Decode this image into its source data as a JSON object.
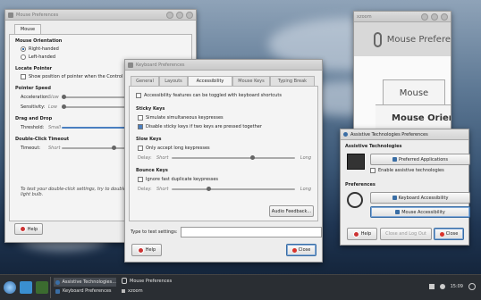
{
  "mouse_window": {
    "title": "Mouse Preferences",
    "tab": "Mouse",
    "orientation_heading": "Mouse Orientation",
    "right_handed": "Right-handed",
    "left_handed": "Left-handed",
    "locate_heading": "Locate Pointer",
    "locate_option": "Show position of pointer when the Control key",
    "speed_heading": "Pointer Speed",
    "acceleration_label": "Acceleration:",
    "acceleration_min": "Slow",
    "sensitivity_label": "Sensitivity:",
    "sensitivity_min": "Low",
    "drag_heading": "Drag and Drop",
    "threshold_label": "Threshold:",
    "threshold_min": "Small",
    "dblclick_heading": "Double-Click Timeout",
    "timeout_label": "Timeout:",
    "timeout_min": "Short",
    "test_text_line1": "To test your double-click settings, try to double-c",
    "test_text_line2": "light bulb.",
    "help_label": "Help"
  },
  "keyboard_window": {
    "title": "Keyboard Preferences",
    "tabs": [
      "General",
      "Layouts",
      "Accessibility",
      "Mouse Keys",
      "Typing Break"
    ],
    "active_tab": "Accessibility",
    "toggle_option": "Accessibility features can be toggled with keyboard shortcuts",
    "sticky_heading": "Sticky Keys",
    "sticky_opt1": "Simulate simultaneous keypresses",
    "sticky_opt2": "Disable sticky keys if two keys are pressed together",
    "slow_heading": "Slow Keys",
    "slow_opt": "Only accept long keypresses",
    "delay_label": "Delay:",
    "delay_min": "Short",
    "delay_max": "Long",
    "slow_delay_level": 0.65,
    "bounce_heading": "Bounce Keys",
    "bounce_opt": "Ignore fast duplicate keypresses",
    "bounce_delay_level": 0.3,
    "audio_button": "Audio Feedback...",
    "test_label": "Type to test settings:",
    "help_label": "Help",
    "close_label": "Close"
  },
  "mouse_zoom_window": {
    "title": "xzoom",
    "header_text": "Mouse Prefere",
    "tab": "Mouse",
    "heading": "Mouse Orienta"
  },
  "assistive_window": {
    "title": "Assistive Technologies Preferences",
    "tech_heading": "Assistive Technologies",
    "preferred_button": "Preferred Applications",
    "enable_label": "Enable assistive technologies",
    "prefs_heading": "Preferences",
    "keyboard_button": "Keyboard Accessibility",
    "mouse_button": "Mouse Accessibility",
    "help_label": "Help",
    "close_logout_label": "Close and Log Out",
    "close_label": "Close"
  },
  "taskbar": {
    "items": [
      {
        "label": "Assistive Technologies..."
      },
      {
        "label": "Keyboard Preferences"
      },
      {
        "label": "Mouse Preferences"
      },
      {
        "label": "xzoom"
      }
    ],
    "clock": "15:09",
    "colors": {
      "bar": "#2a2e33",
      "accent": "#3a6ea5"
    }
  }
}
